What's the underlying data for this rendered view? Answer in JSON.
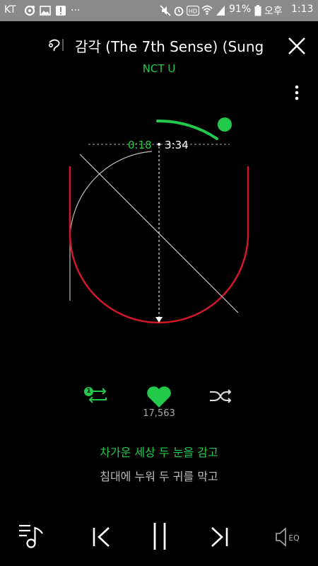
{
  "status_bar": {
    "carrier": "KT",
    "notification_more": "...",
    "battery_percent": "91%",
    "am_pm": "오후",
    "time": "1:13"
  },
  "player": {
    "title": "감각 (The 7th Sense) (Sung",
    "artist": "NCT U",
    "elapsed": "0:18",
    "total": "3:34",
    "progress_fraction": 0.084,
    "likes": "17,563",
    "repeat_badge": "1"
  },
  "lyrics": {
    "current": "차가운 세상 두 눈을 감고",
    "next": "침대에 누워 두 귀를 막고"
  },
  "colors": {
    "accent": "#22c94b",
    "shape_red": "#d0182a",
    "background": "#000000"
  },
  "icons": {
    "playlist": "playlist-icon",
    "prev": "previous-icon",
    "pause": "pause-icon",
    "next": "next-icon",
    "eq": "eq-icon",
    "repeat": "repeat-one-icon",
    "like": "heart-icon",
    "shuffle": "shuffle-icon",
    "close": "close-icon",
    "menu": "more-vertical-icon",
    "song_info": "song-info-icon"
  }
}
